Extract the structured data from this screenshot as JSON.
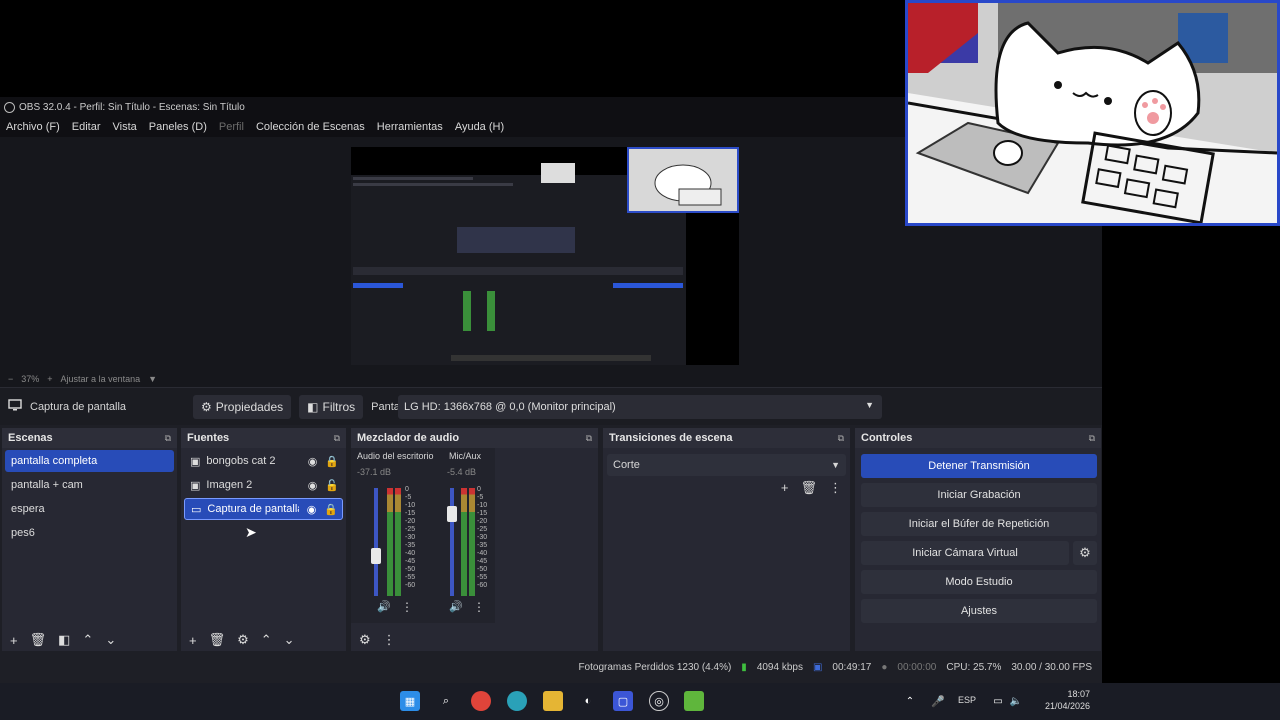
{
  "window": {
    "title": "OBS 32.0.4 - Perfil: Sin Título - Escenas: Sin Título",
    "menu": [
      "Archivo (F)",
      "Editar",
      "Vista",
      "Paneles (D)",
      "Perfil",
      "Colección de Escenas",
      "Herramientas",
      "Ayuda (H)"
    ]
  },
  "zoom": {
    "level": "37%",
    "fit": "Ajustar a la ventana"
  },
  "source_toolbar": {
    "selected_source": "Captura de pantalla",
    "properties": "Propiedades",
    "filters": "Filtros",
    "display_label": "Pantalla",
    "display_value": "LG HD: 1366x768 @ 0,0 (Monitor principal)"
  },
  "scenes": {
    "title": "Escenas",
    "items": [
      "pantalla completa",
      "pantalla + cam",
      "espera",
      "pes6"
    ],
    "selected": 0
  },
  "sources": {
    "title": "Fuentes",
    "items": [
      {
        "name": "bongobs cat 2",
        "icon": "image-icon"
      },
      {
        "name": "Imagen 2",
        "icon": "image-icon"
      },
      {
        "name": "Captura de pantalla",
        "icon": "monitor-icon"
      }
    ],
    "selected": 2
  },
  "mixer": {
    "title": "Mezclador de audio",
    "channels": [
      {
        "name": "Audio del escritorio",
        "db": "-37.1 dB"
      },
      {
        "name": "Mic/Aux",
        "db": "-5.4 dB"
      }
    ],
    "scale": [
      "0",
      "-5",
      "-10",
      "-15",
      "-20",
      "-25",
      "-30",
      "-35",
      "-40",
      "-45",
      "-50",
      "-55",
      "-60"
    ]
  },
  "transitions": {
    "title": "Transiciones de escena",
    "selected": "Corte"
  },
  "controls": {
    "title": "Controles",
    "buttons": [
      "Detener Transmisión",
      "Iniciar Grabación",
      "Iniciar el Búfer de Repetición",
      "Iniciar Cámara Virtual",
      "Modo Estudio",
      "Ajustes"
    ]
  },
  "status": {
    "dropped": "Fotogramas Perdidos 1230 (4.4%)",
    "bitrate": "4094 kbps",
    "stream_time": "00:49:17",
    "rec_time": "00:00:00",
    "cpu": "CPU: 25.7%",
    "fps": "30.00 / 30.00 FPS"
  },
  "taskbar": {
    "lang": "ESP",
    "time": "18:07",
    "date": "21/04/2026"
  },
  "colors": {
    "accent": "#284cb8",
    "panel": "#272833",
    "background": "#1e1f26"
  }
}
